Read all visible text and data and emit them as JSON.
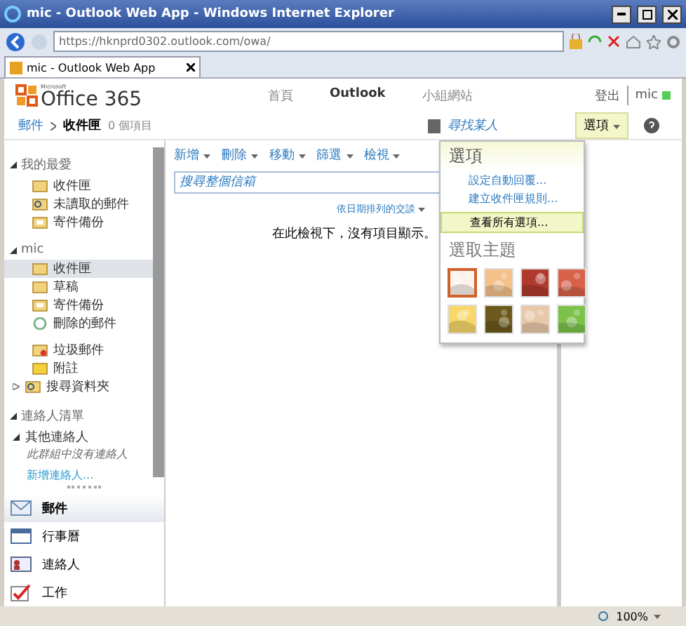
{
  "window": {
    "title": "mic - Outlook Web App - Windows Internet Explorer"
  },
  "address_bar": {
    "url": "https://hknprd0302.outlook.com/owa/"
  },
  "tabs": [
    {
      "label": "mic - Outlook Web App",
      "selected": true
    }
  ],
  "header": {
    "logo_small": "Microsoft",
    "logo": "Office 365",
    "sign_out": "登出",
    "user": "mic",
    "nav": [
      {
        "label": "首頁",
        "selected": false
      },
      {
        "label": "Outlook",
        "selected": true
      },
      {
        "label": "小組網站",
        "selected": false
      }
    ]
  },
  "breadcrumb": {
    "root": "郵件",
    "current": "收件匣",
    "count": "0 個項目",
    "find_people": "尋找某人",
    "options": "選項"
  },
  "sidebar": {
    "groups": [
      {
        "title": "我的最愛",
        "expanded": true,
        "items": [
          {
            "label": "收件匣",
            "kind": "inbox",
            "selected": false
          },
          {
            "label": "未讀取的郵件",
            "kind": "search",
            "selected": false
          },
          {
            "label": "寄件備份",
            "kind": "sent",
            "selected": false
          }
        ]
      },
      {
        "title": "mic",
        "expanded": true,
        "items": [
          {
            "label": "收件匣",
            "kind": "inbox",
            "selected": true
          },
          {
            "label": "草稿",
            "kind": "drafts",
            "selected": false
          },
          {
            "label": "寄件備份",
            "kind": "sent",
            "selected": false
          },
          {
            "label": "刪除的郵件",
            "kind": "deleted",
            "selected": false
          },
          {
            "label": "垃圾郵件",
            "kind": "junk",
            "selected": false
          },
          {
            "label": "附註",
            "kind": "notes",
            "selected": false
          },
          {
            "label": "搜尋資料夾",
            "kind": "search",
            "selected": false,
            "expanded": false
          }
        ]
      }
    ],
    "contacts": {
      "title": "連絡人清單",
      "expanded": true,
      "group": "其他連絡人",
      "empty": "此群組中沒有連絡人",
      "add": "新增連絡人..."
    }
  },
  "bottom_nav": [
    {
      "label": "郵件",
      "kind": "mail",
      "selected": true
    },
    {
      "label": "行事曆",
      "kind": "calendar",
      "selected": false
    },
    {
      "label": "連絡人",
      "kind": "contacts",
      "selected": false
    },
    {
      "label": "工作",
      "kind": "tasks",
      "selected": false
    }
  ],
  "toolbar": [
    "新增",
    "刪除",
    "移動",
    "篩選",
    "檢視"
  ],
  "search": {
    "placeholder": "搜尋整個信箱"
  },
  "list": {
    "sort": "依日期排列的交談",
    "empty": "在此檢視下，沒有項目顯示。"
  },
  "options_menu": {
    "title": "選項",
    "links": [
      "設定自動回覆...",
      "建立收件匣規則..."
    ],
    "highlighted": "查看所有選項...",
    "theme_title": "選取主題",
    "themes": [
      {
        "selected": true,
        "color": "#fbf3ea"
      },
      {
        "selected": false,
        "color": "#f5c08a"
      },
      {
        "selected": false,
        "color": "#b03a2e"
      },
      {
        "selected": false,
        "color": "#d8614a"
      },
      {
        "selected": false,
        "color": "#f7d66a"
      },
      {
        "selected": false,
        "color": "#6b5a1c"
      },
      {
        "selected": false,
        "color": "#e8c8a8"
      },
      {
        "selected": false,
        "color": "#7cc24a"
      }
    ]
  },
  "status_bar": {
    "zoom": "100%"
  }
}
